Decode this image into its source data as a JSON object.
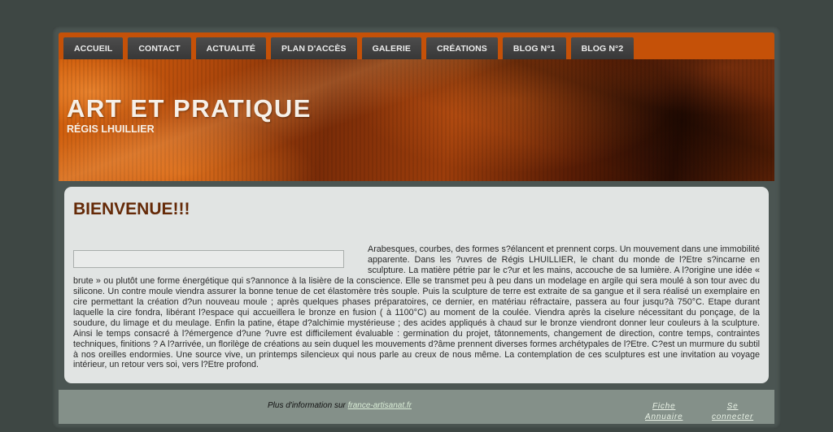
{
  "nav": {
    "items": [
      "ACCUEIL",
      "CONTACT",
      "ACTUALITÉ",
      "PLAN D'ACCÈS",
      "GALERIE",
      "CRÉATIONS",
      "BLOG N°1",
      "BLOG N°2"
    ]
  },
  "header": {
    "title": "ART ET PRATIQUE",
    "subtitle": "RÉGIS LHUILLIER"
  },
  "content": {
    "heading": "BIENVENUE!!!",
    "body": "Arabesques, courbes, des formes s?élancent et prennent corps. Un mouvement dans une immobilité apparente. Dans les ?uvres de Régis LHUILLIER, le chant du monde de l?Etre s?incarne en sculpture. La matière pétrie par le c?ur et les mains, accouche de sa lumière. A l?origine une idée « brute » ou plutôt une forme énergétique qui s?annonce à la lisière de la conscience. Elle se transmet peu à peu dans un modelage en argile qui sera moulé à son tour avec du silicone. Un contre moule viendra assurer la bonne tenue de cet élastomère très souple. Puis la sculpture de terre est extraite de sa gangue et il sera réalisé un exemplaire en cire permettant la création d?un nouveau moule ; après quelques phases préparatoires, ce dernier, en matériau réfractaire, passera au four jusqu?à 750°C. Etape durant laquelle la cire fondra, libérant l?espace qui accueillera le bronze en fusion ( à 1100°C) au moment de la coulée. Viendra après la ciselure nécessitant du ponçage, de la soudure, du limage et du meulage. Enfin la patine, étape d?alchimie mystérieuse ; des acides appliqués à chaud sur le bronze viendront donner leur couleurs à la sculpture. Ainsi le temps consacré à l?émergence d?une ?uvre est difficilement évaluable : germination du projet, tâtonnements, changement de direction, contre temps, contraintes techniques, finitions ? A l?arrivée, un florilège de créations au sein duquel les  mouvements d?âme prennent diverses formes archétypales de l?Etre. C?est un murmure du subtil à nos oreilles endormies. Une source vive, un printemps silencieux qui nous parle au creux de nous même. La contemplation de ces sculptures est une invitation au voyage intérieur, un retour vers soi, vers l?Etre profond."
  },
  "footer": {
    "info_text": "Plus d'information sur ",
    "info_link": "france-artisanat.fr",
    "fiche_line1": "Fiche",
    "fiche_line2": "Annuaire",
    "login_line1": "Se",
    "login_line2": "connecter"
  },
  "colors": {
    "nav_bar": "#c55108",
    "nav_item": "#3f3f3f",
    "title_brown": "#652a08",
    "background": "#3e4744",
    "footer": "#849089"
  }
}
